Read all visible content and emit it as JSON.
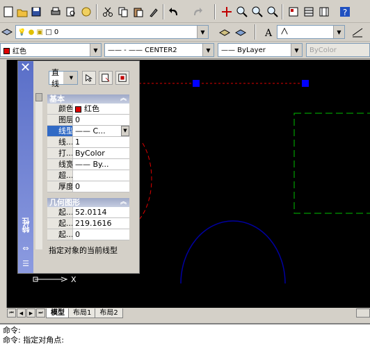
{
  "toolbar_row1": {
    "icons": [
      "new-icon",
      "open-icon",
      "save-icon",
      "print-icon",
      "plot-preview-icon",
      "publish-icon",
      "cut-icon",
      "copy-icon",
      "paste-icon",
      "match-properties-icon",
      "undo-icon",
      "redo-icon",
      "pan-icon",
      "zoom-realtime-icon",
      "zoom-window-icon",
      "zoom-previous-icon",
      "properties-icon",
      "design-center-icon",
      "tool-palettes-icon",
      "help-icon"
    ]
  },
  "layer_toolbar": {
    "layer_value": "0"
  },
  "properties_toolbar": {
    "color": "红色",
    "linetype": "—— - —— CENTER2",
    "lineweight": "—— ByLayer",
    "plotstyle": "ByColor"
  },
  "properties_palette": {
    "object_type": "直线",
    "sections": [
      {
        "title": "基本",
        "rows": [
          {
            "key": "颜色",
            "value": "红色"
          },
          {
            "key": "图层",
            "value": "0"
          },
          {
            "key": "线型",
            "value": "—— C..."
          },
          {
            "key": "线...",
            "value": "1"
          },
          {
            "key": "打...",
            "value": "ByColor"
          },
          {
            "key": "线宽",
            "value": "—— By..."
          },
          {
            "key": "超...",
            "value": ""
          },
          {
            "key": "厚度",
            "value": "0"
          }
        ]
      },
      {
        "title": "几何图形",
        "rows": [
          {
            "key": "起...",
            "value": "52.0114"
          },
          {
            "key": "起...",
            "value": "219.1616"
          },
          {
            "key": "起...",
            "value": "0"
          }
        ]
      }
    ],
    "description": "指定对象的当前线型",
    "vertical_title": "特性"
  },
  "ucs": {
    "x_label": "X"
  },
  "layout_tabs": [
    "模型",
    "布局1",
    "布局2"
  ],
  "command_lines": [
    "命令:",
    "命令:   指定对角点:"
  ],
  "colors": {
    "accent_red": "#e00000",
    "grip_blue": "#0000ff",
    "green_dash": "#00c000",
    "arc_blue": "#0000a0"
  }
}
